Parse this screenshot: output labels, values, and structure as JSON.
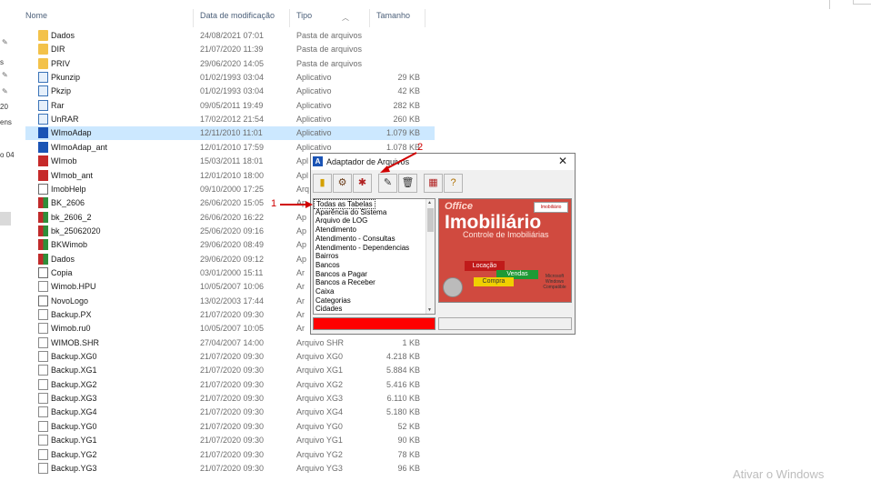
{
  "columns": {
    "name": "Nome",
    "date": "Data de modificação",
    "type": "Tipo",
    "size": "Tamanho"
  },
  "left_fragments": [
    "s",
    "ens",
    "20",
    "o 04"
  ],
  "files": [
    {
      "name": "Dados",
      "date": "24/08/2021 07:01",
      "type": "Pasta de arquivos",
      "size": "",
      "icon": "folder-icon",
      "ic": "ic-folder"
    },
    {
      "name": "DIR",
      "date": "21/07/2020 11:39",
      "type": "Pasta de arquivos",
      "size": "",
      "icon": "folder-icon",
      "ic": "ic-folder"
    },
    {
      "name": "PRIV",
      "date": "29/06/2020 14:05",
      "type": "Pasta de arquivos",
      "size": "",
      "icon": "folder-icon",
      "ic": "ic-folder"
    },
    {
      "name": "Pkunzip",
      "date": "01/02/1993 03:04",
      "type": "Aplicativo",
      "size": "29 KB",
      "icon": "application-icon",
      "ic": "ic-app"
    },
    {
      "name": "Pkzip",
      "date": "01/02/1993 03:04",
      "type": "Aplicativo",
      "size": "42 KB",
      "icon": "application-icon",
      "ic": "ic-app"
    },
    {
      "name": "Rar",
      "date": "09/05/2011 19:49",
      "type": "Aplicativo",
      "size": "282 KB",
      "icon": "application-icon",
      "ic": "ic-app"
    },
    {
      "name": "UnRAR",
      "date": "17/02/2012 21:54",
      "type": "Aplicativo",
      "size": "260 KB",
      "icon": "application-icon",
      "ic": "ic-app"
    },
    {
      "name": "WImoAdap",
      "date": "12/11/2010 11:01",
      "type": "Aplicativo",
      "size": "1.079 KB",
      "icon": "wimo-app-icon",
      "ic": "ic-blue",
      "selected": true
    },
    {
      "name": "WImoAdap_ant",
      "date": "12/01/2010 17:59",
      "type": "Aplicativo",
      "size": "1.078 KB",
      "icon": "wimo-app-icon",
      "ic": "ic-blue"
    },
    {
      "name": "WImob",
      "date": "15/03/2011 18:01",
      "type": "Apl",
      "size": "",
      "icon": "imob-app-icon",
      "ic": "ic-red"
    },
    {
      "name": "WImob_ant",
      "date": "12/01/2010 18:00",
      "type": "Apl",
      "size": "",
      "icon": "imob-app-icon",
      "ic": "ic-red"
    },
    {
      "name": "ImobHelp",
      "date": "09/10/2000 17:25",
      "type": "Arq",
      "size": "",
      "icon": "help-file-icon",
      "ic": "ic-misc"
    },
    {
      "name": "BK_2606",
      "date": "26/06/2020 15:05",
      "type": "Ap",
      "size": "",
      "icon": "archive-icon",
      "ic": "ic-multi"
    },
    {
      "name": "bk_2606_2",
      "date": "26/06/2020 16:22",
      "type": "Ap",
      "size": "",
      "icon": "archive-icon",
      "ic": "ic-multi"
    },
    {
      "name": "bk_25062020",
      "date": "25/06/2020 09:16",
      "type": "Ap",
      "size": "",
      "icon": "archive-icon",
      "ic": "ic-multi"
    },
    {
      "name": "BKWimob",
      "date": "29/06/2020 08:49",
      "type": "Ap",
      "size": "",
      "icon": "archive-icon",
      "ic": "ic-multi"
    },
    {
      "name": "Dados",
      "date": "29/06/2020 09:12",
      "type": "Ap",
      "size": "",
      "icon": "archive-icon",
      "ic": "ic-multi"
    },
    {
      "name": "Copia",
      "date": "03/01/2000 15:11",
      "type": "Ar",
      "size": "",
      "icon": "file-icon",
      "ic": "ic-misc"
    },
    {
      "name": "Wimob.HPU",
      "date": "10/05/2007 10:06",
      "type": "Ar",
      "size": "",
      "icon": "file-icon",
      "ic": "ic-file"
    },
    {
      "name": "NovoLogo",
      "date": "13/02/2003 17:44",
      "type": "Ar",
      "size": "",
      "icon": "image-file-icon",
      "ic": "ic-misc"
    },
    {
      "name": "Backup.PX",
      "date": "21/07/2020 09:30",
      "type": "Ar",
      "size": "",
      "icon": "file-icon",
      "ic": "ic-file"
    },
    {
      "name": "Wimob.ru0",
      "date": "10/05/2007 10:05",
      "type": "Ar",
      "size": "",
      "icon": "file-icon",
      "ic": "ic-file"
    },
    {
      "name": "WIMOB.SHR",
      "date": "27/04/2007 14:00",
      "type": "Arquivo SHR",
      "size": "1 KB",
      "icon": "file-icon",
      "ic": "ic-file"
    },
    {
      "name": "Backup.XG0",
      "date": "21/07/2020 09:30",
      "type": "Arquivo XG0",
      "size": "4.218 KB",
      "icon": "file-icon",
      "ic": "ic-file"
    },
    {
      "name": "Backup.XG1",
      "date": "21/07/2020 09:30",
      "type": "Arquivo XG1",
      "size": "5.884 KB",
      "icon": "file-icon",
      "ic": "ic-file"
    },
    {
      "name": "Backup.XG2",
      "date": "21/07/2020 09:30",
      "type": "Arquivo XG2",
      "size": "5.416 KB",
      "icon": "file-icon",
      "ic": "ic-file"
    },
    {
      "name": "Backup.XG3",
      "date": "21/07/2020 09:30",
      "type": "Arquivo XG3",
      "size": "6.110 KB",
      "icon": "file-icon",
      "ic": "ic-file"
    },
    {
      "name": "Backup.XG4",
      "date": "21/07/2020 09:30",
      "type": "Arquivo XG4",
      "size": "5.180 KB",
      "icon": "file-icon",
      "ic": "ic-file"
    },
    {
      "name": "Backup.YG0",
      "date": "21/07/2020 09:30",
      "type": "Arquivo YG0",
      "size": "52 KB",
      "icon": "file-icon",
      "ic": "ic-file"
    },
    {
      "name": "Backup.YG1",
      "date": "21/07/2020 09:30",
      "type": "Arquivo YG1",
      "size": "90 KB",
      "icon": "file-icon",
      "ic": "ic-file"
    },
    {
      "name": "Backup.YG2",
      "date": "21/07/2020 09:30",
      "type": "Arquivo YG2",
      "size": "78 KB",
      "icon": "file-icon",
      "ic": "ic-file"
    },
    {
      "name": "Backup.YG3",
      "date": "21/07/2020 09:30",
      "type": "Arquivo YG3",
      "size": "96 KB",
      "icon": "file-icon",
      "ic": "ic-file"
    }
  ],
  "dialog": {
    "title": "Adaptador de Arquivos",
    "close_glyph": "✕",
    "toolbar": [
      {
        "icon": "exit-door-icon",
        "glyph": "▮",
        "color": "#d4a000"
      },
      {
        "icon": "adapt-tool-icon",
        "glyph": "⚙",
        "color": "#6b3d1a"
      },
      {
        "icon": "adapt-all-icon",
        "glyph": "✱",
        "color": "#b02020"
      },
      {
        "icon": "repair-icon",
        "glyph": "✎",
        "color": "#333333"
      },
      {
        "icon": "trash-icon",
        "glyph": "🗑",
        "color": "#333333"
      },
      {
        "icon": "config-icon",
        "glyph": "▦",
        "color": "#b02020"
      },
      {
        "icon": "help-icon",
        "glyph": "?",
        "color": "#b07000"
      }
    ],
    "tables": [
      "Todas as Tabelas",
      "Aparência do Sistema",
      "Arquivo de LOG",
      "Atendimento",
      "Atendimento - Consultas",
      "Atendimento - Dependencias",
      "Bairros",
      "Bancos",
      "Bancos a Pagar",
      "Bancos a Receber",
      "Caixa",
      "Categorias",
      "Cidades"
    ],
    "logo": {
      "office": "Office",
      "brand": "Imobiliário",
      "subtitle": "Controle de Imobiliárias",
      "tag": "Imobiliário",
      "b1": "Locação",
      "b2": "Vendas",
      "b3": "Compra",
      "ms": "Microsoft Windows Compatible"
    }
  },
  "annotations": {
    "a1": "1",
    "a2": "2"
  },
  "watermark": "Ativar o Windows",
  "colors": {
    "selection": "#cce8ff",
    "progress": "#ff0000",
    "annotation": "#d00000"
  }
}
